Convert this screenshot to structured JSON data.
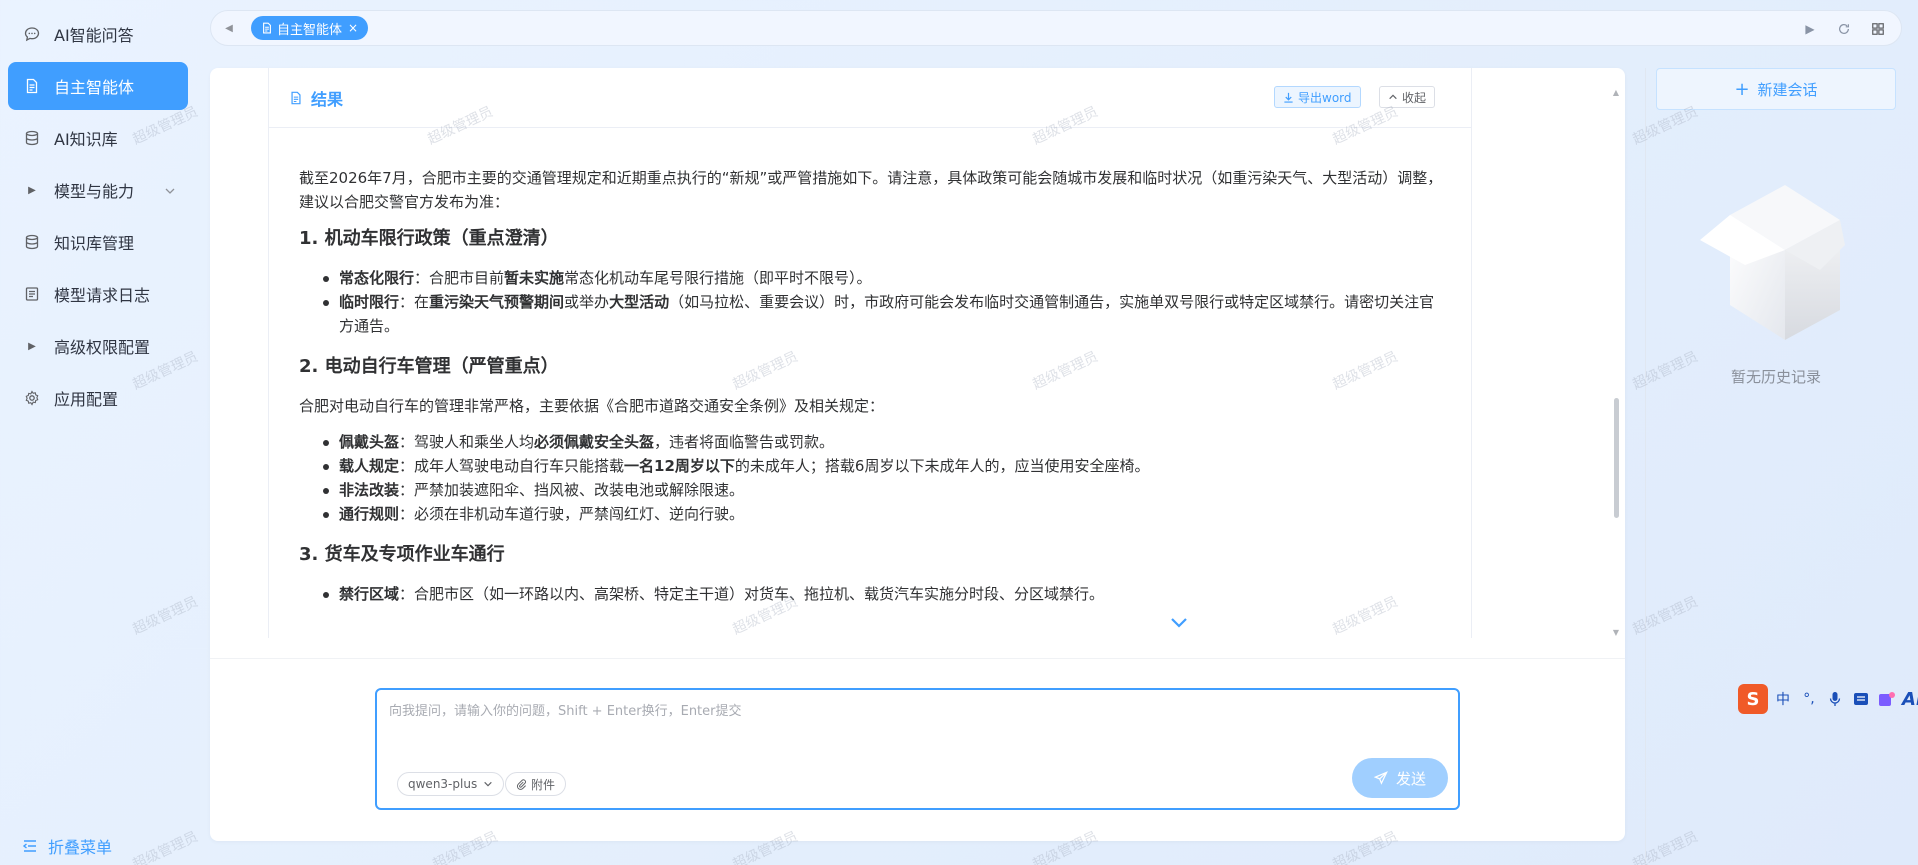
{
  "sidebar": {
    "items": [
      {
        "label": "AI智能问答"
      },
      {
        "label": "自主智能体"
      },
      {
        "label": "AI知识库"
      },
      {
        "label": "模型与能力"
      },
      {
        "label": "知识库管理"
      },
      {
        "label": "模型请求日志"
      },
      {
        "label": "高级权限配置"
      },
      {
        "label": "应用配置"
      }
    ],
    "collapse_label": "折叠菜单"
  },
  "tabbar": {
    "active_tab": "自主智能体",
    "close_glyph": "×"
  },
  "result": {
    "title": "结果",
    "export_label": "导出word",
    "collapse_label": "收起",
    "intro": "截至2026年7月，合肥市主要的交通管理规定和近期重点执行的“新规”或严管措施如下。请注意，具体政策可能会随城市发展和临时状况（如重污染天气、大型活动）调整，建议以合肥交警官方发布为准：",
    "section1": {
      "heading": "1. 机动车限行政策（重点澄清）",
      "items": [
        {
          "bold": "常态化限行",
          "pre": "：合肥市目前",
          "bold2": "暂未实施",
          "rest": "常态化机动车尾号限行措施（即平时不限号）。"
        },
        {
          "bold": "临时限行",
          "pre": "：在",
          "bold2": "重污染天气预警期间",
          "mid": "或举办",
          "bold3": "大型活动",
          "rest": "（如马拉松、重要会议）时，市政府可能会发布临时交通管制通告，实施单双号限行或特定区域禁行。请密切关注官方通告。"
        }
      ]
    },
    "section2": {
      "heading": "2. 电动自行车管理（严管重点）",
      "intro": "合肥对电动自行车的管理非常严格，主要依据《合肥市道路交通安全条例》及相关规定：",
      "items": [
        {
          "bold": "佩戴头盔",
          "pre": "：驾驶人和乘坐人均",
          "bold2": "必须佩戴安全头盔",
          "rest": "，违者将面临警告或罚款。"
        },
        {
          "bold": "载人规定",
          "pre": "：成年人驾驶电动自行车只能搭载",
          "bold2": "一名12周岁以下",
          "rest": "的未成年人；搭载6周岁以下未成年人的，应当使用安全座椅。"
        },
        {
          "bold": "非法改装",
          "rest": "：严禁加装遮阳伞、挡风被、改装电池或解除限速。"
        },
        {
          "bold": "通行规则",
          "rest": "：必须在非机动车道行驶，严禁闯红灯、逆向行驶。"
        }
      ]
    },
    "section3": {
      "heading": "3. 货车及专项作业车通行",
      "items": [
        {
          "bold": "禁行区域",
          "rest": "：合肥市区（如一环路以内、高架桥、特定主干道）对货车、拖拉机、载货汽车实施分时段、分区域禁行。"
        }
      ]
    }
  },
  "composer": {
    "placeholder": "向我提问，请输入你的问题，Shift + Enter换行，Enter提交",
    "model": "qwen3-plus",
    "attach_label": "附件",
    "send_label": "发送"
  },
  "history": {
    "new_chat_label": "新建会话",
    "empty_text": "暂无历史记录"
  },
  "ime": {
    "logo": "S",
    "lang": "中",
    "punct": "°,",
    "ai": "Ai"
  },
  "watermark_text": "超级管理员",
  "colors": {
    "accent": "#409eff",
    "send_disabled": "#a0cfff"
  }
}
